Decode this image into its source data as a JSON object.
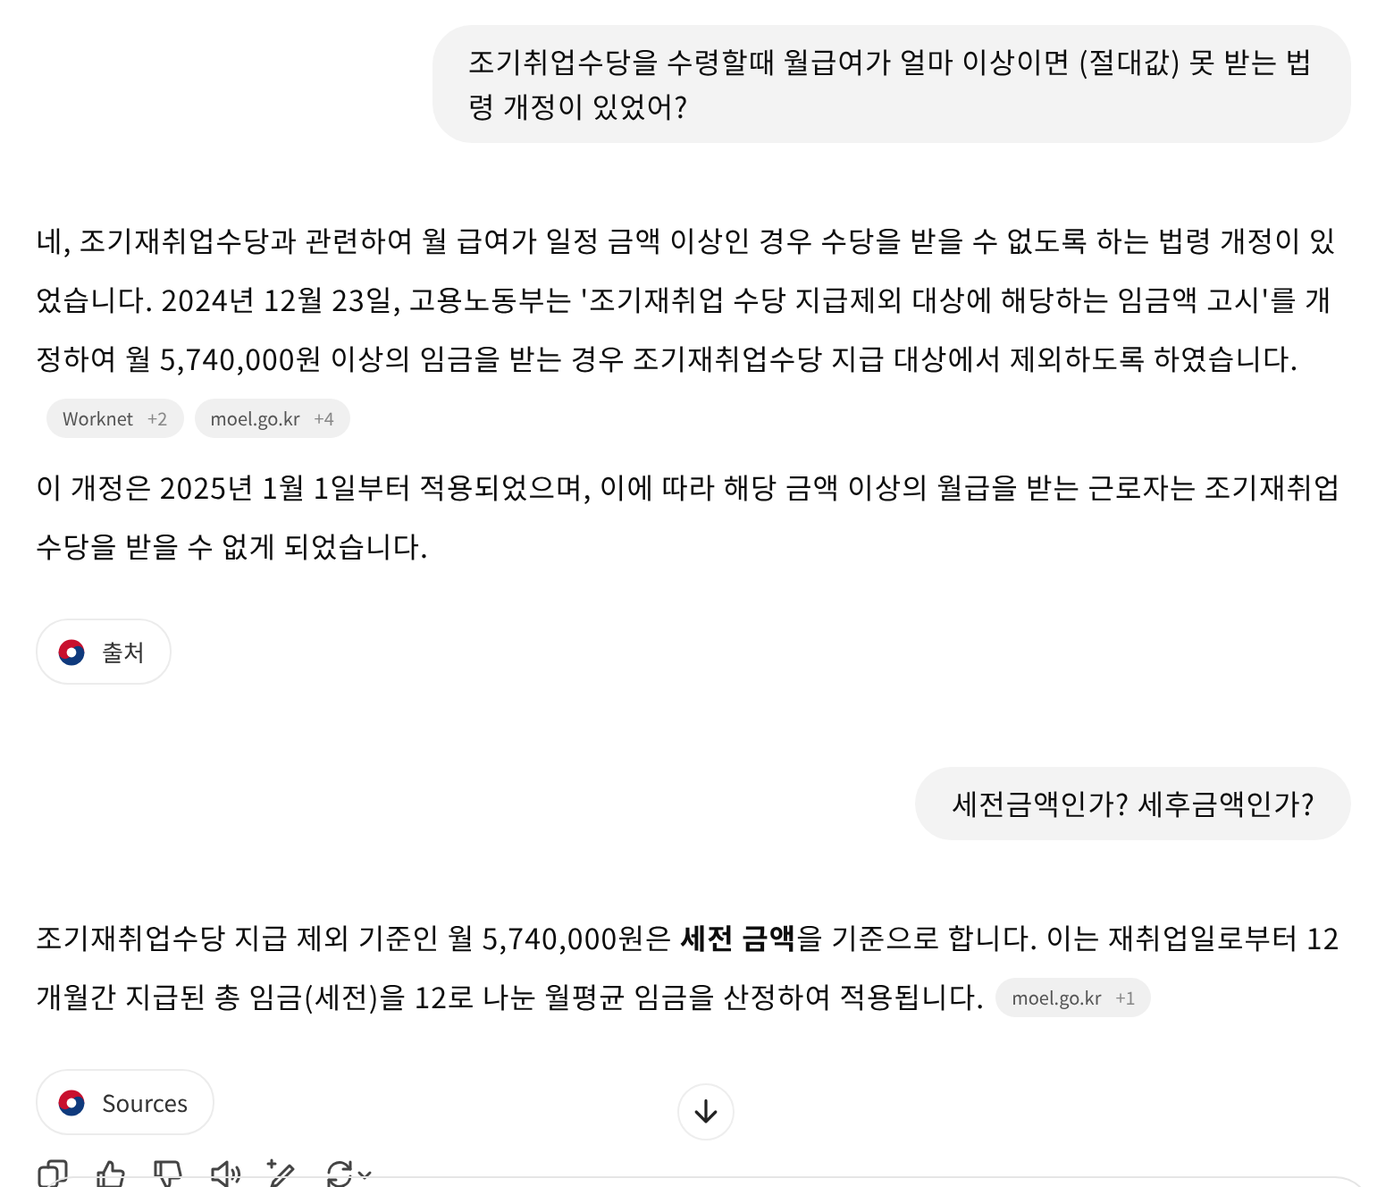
{
  "messages": [
    {
      "kind": "user",
      "text": "조기취업수당을 수령할때 월급여가 얼마 이상이면 (절대값) 못 받는 법령 개정이 있었어?"
    },
    {
      "kind": "assistant",
      "paragraphs": [
        {
          "text": "네, 조기재취업수당과 관련하여 월 급여가 일정 금액 이상인 경우 수당을 받을 수 없도록 하는 법령 개정이 있었습니다. 2024년 12월 23일, 고용노동부는 '조기재취업 수당 지급제외 대상에 해당하는 임금액 고시'를 개정하여 월 5,740,000원 이상의 임금을 받는 경우 조기재취업수당 지급 대상에서 제외하도록 하였습니다.",
          "citations": [
            {
              "source": "Worknet",
              "count": "+2"
            },
            {
              "source": "moel.go.kr",
              "count": "+4"
            }
          ]
        },
        {
          "text": "이 개정은 2025년 1월 1일부터 적용되었으며, 이에 따라 해당 금액 이상의 월급을 받는 근로자는 조기재취업수당을 받을 수 없게 되었습니다."
        }
      ],
      "sources_label": "출처"
    },
    {
      "kind": "user",
      "text": "세전금액인가? 세후금액인가?"
    },
    {
      "kind": "assistant",
      "paragraphs": [
        {
          "text": "조기재취업수당 지급 제외 기준인 월 5,740,000원은 **세전 금액**을 기준으로 합니다. 이는 재취업일로부터 12개월간 지급된 총 임금(세전)을 12로 나눈 월평균 임금을 산정하여 적용됩니다.",
          "citations": [
            {
              "source": "moel.go.kr",
              "count": "+1"
            }
          ]
        }
      ],
      "sources_label": "Sources",
      "show_actions": true
    }
  ]
}
